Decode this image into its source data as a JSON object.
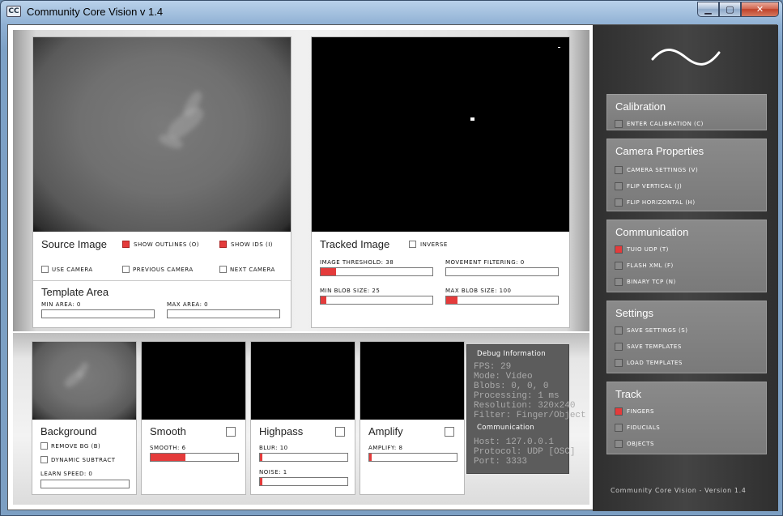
{
  "window": {
    "title": "Community Core Vision v 1.4",
    "icon_text": "CC",
    "min": "▁",
    "max": "▢",
    "close": "✕"
  },
  "source": {
    "title": "Source Image",
    "show_outlines": "SHOW OUTLINES (O)",
    "show_ids": "SHOW IDS (I)",
    "use_camera": "USE CAMERA",
    "previous_camera": "PREVIOUS CAMERA",
    "next_camera": "NEXT CAMERA"
  },
  "template": {
    "title": "Template Area",
    "min_area": "MIN AREA: 0",
    "max_area": "MAX AREA: 0",
    "min_area_value": 0,
    "max_area_value": 0
  },
  "tracked": {
    "title": "Tracked Image",
    "inverse": "INVERSE",
    "image_threshold": "IMAGE THRESHOLD: 38",
    "image_threshold_value": 0.14,
    "movement_filtering": "MOVEMENT FILTERING: 0",
    "movement_filtering_value": 0,
    "min_blob": "MIN BLOB SIZE: 25",
    "min_blob_value": 0.05,
    "max_blob": "MAX BLOB SIZE: 100",
    "max_blob_value": 0.1
  },
  "filters": {
    "background": {
      "title": "Background",
      "remove_bg": "REMOVE BG (B)",
      "dynamic_subtract": "DYNAMIC SUBTRACT",
      "learn_speed": "LEARN SPEED: 0",
      "learn_speed_value": 0
    },
    "smooth": {
      "title": "Smooth",
      "smooth": "SMOOTH: 6",
      "smooth_value": 0.4
    },
    "highpass": {
      "title": "Highpass",
      "blur": "BLUR: 10",
      "blur_value": 0.03,
      "noise": "NOISE: 1",
      "noise_value": 0.03
    },
    "amplify": {
      "title": "Amplify",
      "amplify": "AMPLIFY: 8",
      "amplify_value": 0.03
    }
  },
  "debug": {
    "title": "Debug Information",
    "fps": "FPS:  29",
    "mode": "Mode:  Video",
    "blobs": "Blobs:  0, 0, 0",
    "processing": "Processing:  1 ms",
    "resolution": "Resolution:  320x240",
    "filter": "Filter:  Finger/Object",
    "comm_title": "Communication",
    "host": "Host:  127.0.0.1",
    "protocol": "Protocol:  UDP [OSC]",
    "port": "Port:  3333"
  },
  "sidebar": {
    "calibration": {
      "title": "Calibration",
      "enter": "ENTER CALIBRATION (C)"
    },
    "camera": {
      "title": "Camera Properties",
      "settings": "CAMERA SETTINGS (V)",
      "flip_v": "FLIP VERTICAL (J)",
      "flip_h": "FLIP HORIZONTAL (H)"
    },
    "communication": {
      "title": "Communication",
      "tuio": "TUIO UDP (T)",
      "flash": "FLASH XML (F)",
      "binary": "BINARY TCP (N)"
    },
    "settings": {
      "title": "Settings",
      "save_settings": "SAVE SETTINGS (S)",
      "save_templates": "SAVE TEMPLATES",
      "load_templates": "LOAD TEMPLATES"
    },
    "track": {
      "title": "Track",
      "fingers": "FINGERS",
      "fiducials": "FIDUCIALS",
      "objects": "OBJECTS"
    },
    "footer": "Community Core Vision - Version 1.4"
  },
  "colors": {
    "accent": "#e43b3b",
    "sidebar": "#3a3a3a",
    "panel_box": "#808080"
  }
}
